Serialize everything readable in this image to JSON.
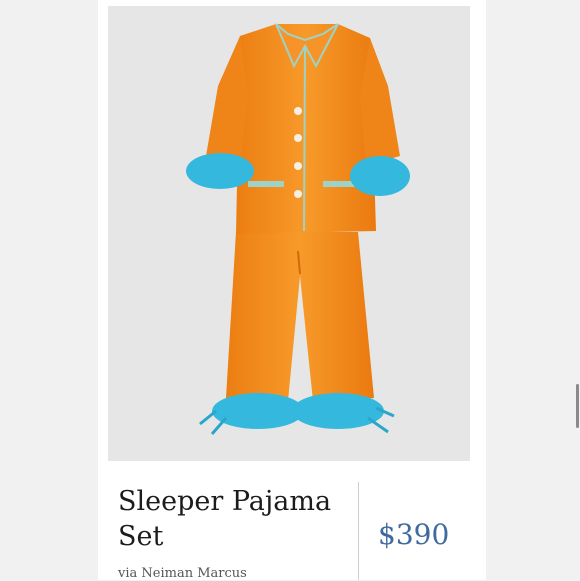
{
  "product": {
    "title": "Sleeper Pajama Set",
    "price": "$390",
    "source": "via Neiman Marcus"
  },
  "image": {
    "subject": "orange-pajama-set-with-blue-feather-trim"
  },
  "colors": {
    "pajama_orange": "#f28a1c",
    "feather_blue": "#35b8dd",
    "price_blue": "#3e6aa0",
    "photo_bg": "#e7e6e6"
  }
}
